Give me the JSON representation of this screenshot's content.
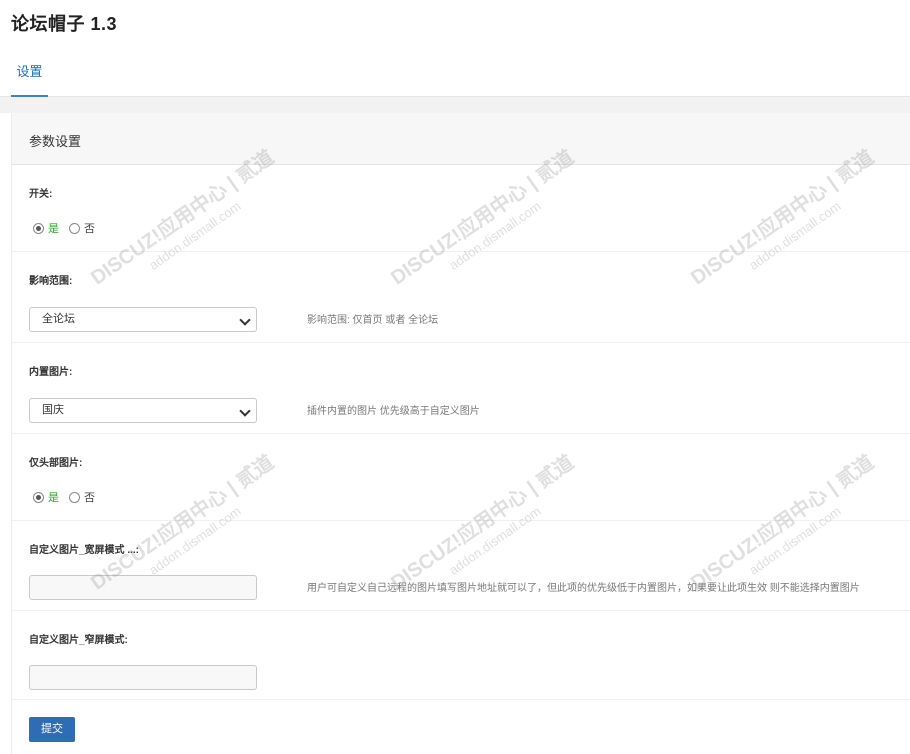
{
  "header": {
    "title": "论坛帽子 1.3",
    "tab_label": "设置"
  },
  "panel": {
    "title": "参数设置"
  },
  "fields": {
    "switch": {
      "label": "开关:",
      "yes": "是",
      "no": "否",
      "selected": "yes"
    },
    "scope": {
      "label": "影响范围:",
      "value": "全论坛",
      "hint": "影响范围: 仅首页 或者 全论坛"
    },
    "builtin_image": {
      "label": "内置图片:",
      "value": "国庆",
      "hint": "插件内置的图片 优先级高于自定义图片"
    },
    "header_only": {
      "label": "仅头部图片:",
      "yes": "是",
      "no": "否",
      "selected": "yes"
    },
    "custom_wide": {
      "label": "自定义图片_宽屏模式 ...:",
      "value": "",
      "hint": "用户可自定义自己远程的图片填写图片地址就可以了，但此项的优先级低于内置图片，如果要让此项生效 则不能选择内置图片"
    },
    "custom_narrow": {
      "label": "自定义图片_窄屏模式:",
      "value": ""
    }
  },
  "actions": {
    "submit_label": "提交"
  },
  "watermark": {
    "line1": "DISCUZ!应用中心 | 贰道",
    "line2": "addon.dismall.com"
  },
  "colors": {
    "accent": "#2e6db5",
    "yes_text": "#2aa52a",
    "tab_text": "#1e6fbf"
  }
}
